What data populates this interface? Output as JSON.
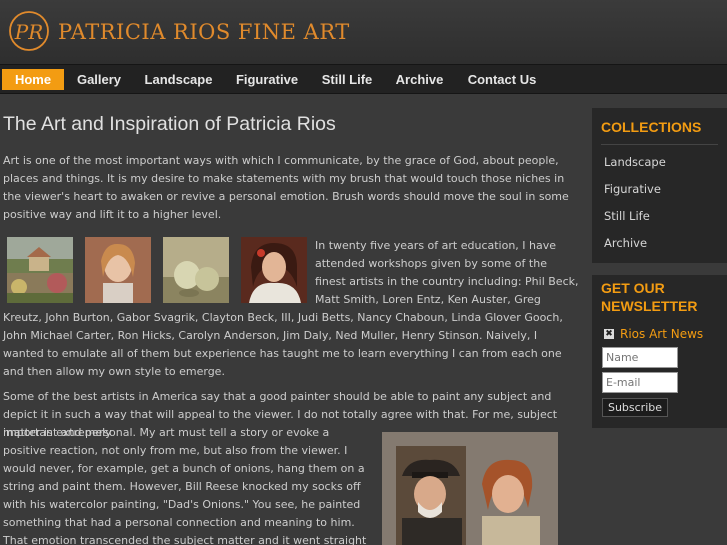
{
  "header": {
    "site_title": "PATRICIA RIOS FINE ART",
    "logo_monogram": "PR",
    "accent": "#e08a2c"
  },
  "nav": {
    "items": [
      "Home",
      "Gallery",
      "Landscape",
      "Figurative",
      "Still Life",
      "Archive",
      "Contact Us"
    ],
    "active": "Home",
    "active_color": "#f39c12"
  },
  "main": {
    "title": "The Art and Inspiration of Patricia Rios",
    "intro": "Art is one of the most important ways with which I communicate, by the grace of God, about people, places and things. It is my desire to make statements with my brush that would touch those niches in the viewer's heart to awaken or revive a personal emotion. Brush words should move the soul in some positive way and lift it to a higher level.",
    "education": "In twenty five years of art education, I have attended workshops given by some of the finest artists in the country including: Phil Beck, Matt Smith, Loren Entz, Ken Auster, Greg Kreutz, John Burton, Gabor Svagrik, Clayton Beck, III, Judi Betts, Nancy Chaboun, Linda Glover Gooch, John Michael Carter, Ron Hicks, Carolyn Anderson, Jim Daly, Ned Muller, Henry Stinson. Naively, I wanted to emulate all of them but experience has taught me to learn everything I can from each one and then allow my own style to emerge.",
    "subject_a": "Some of the best artists in America say that a good painter should be able to paint any subject and depict it in such a way that will appeal to the viewer. I do not totally agree with that. For me, subject matter is extremely",
    "subject_b": "important and personal. My art must tell a story or evoke a positive reaction, not only from me, but also from the viewer. I would never, for example, get a bunch of onions, hang them on a string and paint them. However, Bill Reese knocked my socks off with his watercolor painting, \"Dad's Onions.\" You see, he painted something that had a personal connection and meaning to him. That emotion transcended the subject matter and it went straight to my heart."
  },
  "sidebar": {
    "collections_title": "COLLECTIONS",
    "collections": [
      "Landscape",
      "Figurative",
      "Still Life",
      "Archive"
    ],
    "newsletter_title": "GET OUR NEWSLETTER",
    "rss_label": "Rios Art News",
    "name_placeholder": "Name",
    "email_placeholder": "E-mail",
    "subscribe_label": "Subscribe"
  }
}
